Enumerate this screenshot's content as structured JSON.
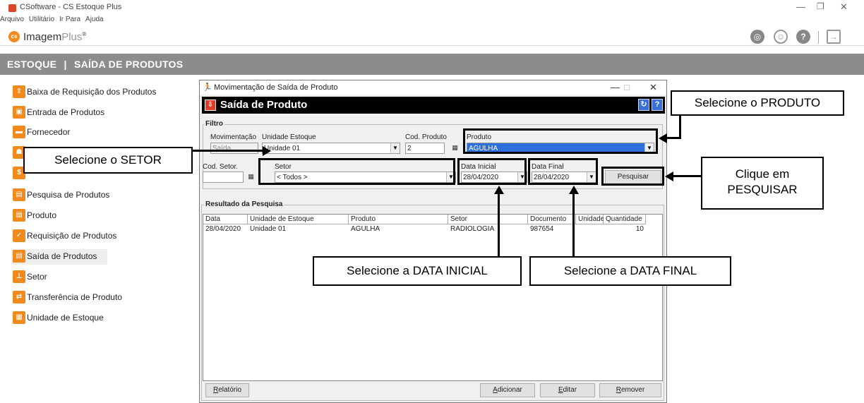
{
  "window": {
    "title": "CSoftware - CS Estoque Plus"
  },
  "menu": [
    "Arquivo",
    "Utilitário",
    "Ir Para",
    "Ajuda"
  ],
  "brand": {
    "name": "Imagem",
    "plus": "Plus",
    "mark": "®",
    "logo_text": "cs"
  },
  "header": {
    "module": "ESTOQUE",
    "separator": "|",
    "page": "SAÍDA DE PRODUTOS"
  },
  "sidebar": {
    "items": [
      {
        "label": "Baixa de Requisição dos Produtos",
        "icon": "export-box-icon"
      },
      {
        "label": "Entrada de Produtos",
        "icon": "gift-box-icon"
      },
      {
        "label": "Fornecedor",
        "icon": "truck-icon"
      },
      {
        "label": "",
        "icon": "people-icon"
      },
      {
        "label": "",
        "icon": "dollar-icon"
      },
      {
        "label": "Pesquisa de Produtos",
        "icon": "database-icon"
      },
      {
        "label": "Produto",
        "icon": "database-icon"
      },
      {
        "label": "Requisição de Produtos",
        "icon": "check-list-icon"
      },
      {
        "label": "Saída de Produtos",
        "icon": "export-list-icon",
        "active": true
      },
      {
        "label": "Setor",
        "icon": "org-chart-icon"
      },
      {
        "label": "Transferência de Produto",
        "icon": "transfer-icon"
      },
      {
        "label": "Unidade de Estoque",
        "icon": "storage-icon"
      }
    ]
  },
  "dialog": {
    "title": "Movimentação de Saída de Produto",
    "header": "Saída de Produto",
    "filter": {
      "group_label": "Filtro",
      "movimentacao_label": "Movimentação",
      "movimentacao_value": "Saída",
      "unidade_label": "Unidade Estoque",
      "unidade_value": "Unidade 01",
      "cod_produto_label": "Cod. Produto",
      "cod_produto_value": "2",
      "produto_label": "Produto",
      "produto_value": "AGULHA",
      "cod_setor_label": "Cod. Setor.",
      "cod_setor_value": "",
      "setor_label": "Setor",
      "setor_value": "< Todos >",
      "data_inicial_label": "Data Inicial",
      "data_inicial_value": "28/04/2020",
      "data_final_label": "Data Final",
      "data_final_value": "28/04/2020",
      "pesquisar_label": "Pesquisar"
    },
    "results": {
      "group_label": "Resultado da Pesquisa",
      "columns": [
        "Data",
        "Unidade de Estoque",
        "Produto",
        "Setor",
        "Documento",
        "Unidade",
        "Quantidade"
      ],
      "rows": [
        [
          "28/04/2020",
          "Unidade 01",
          "AGULHA",
          "RADIOLOGIA",
          "987654",
          "",
          "10"
        ]
      ]
    },
    "buttons": {
      "relatorio": {
        "first": "R",
        "rest": "elatório"
      },
      "adicionar": {
        "first": "A",
        "rest": "dicionar"
      },
      "editar": {
        "first": "E",
        "rest": "ditar"
      },
      "remover": {
        "first": "R",
        "rest": "emover"
      }
    }
  },
  "callouts": {
    "produto": "Selecione o PRODUTO",
    "setor": "Selecione o SETOR",
    "pesquisar_line1": "Clique em",
    "pesquisar_line2": "PESQUISAR",
    "data_inicial": "Selecione a DATA INICIAL",
    "data_final": "Selecione a DATA FINAL"
  }
}
